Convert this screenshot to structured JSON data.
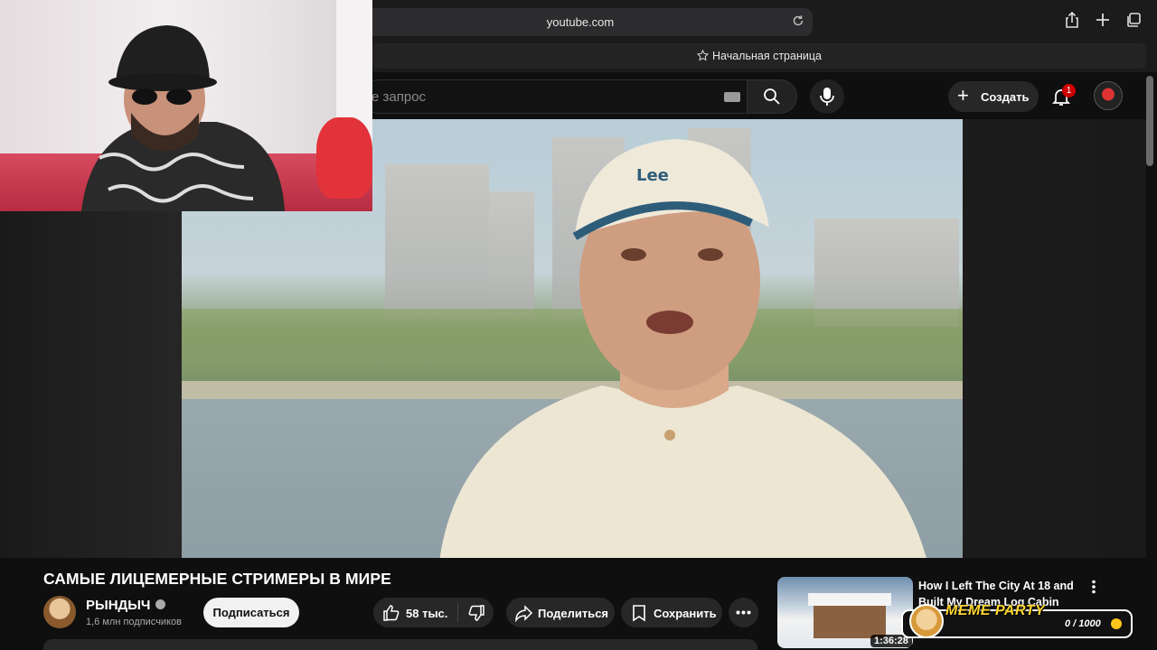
{
  "browser": {
    "url": "youtube.com",
    "tab_title": "Начальная страница"
  },
  "header": {
    "search_placeholder": "е запрос",
    "create_label": "Создать",
    "notification_count": "1"
  },
  "video": {
    "title": "САМЫЕ ЛИЦЕМЕРНЫЕ СТРИМЕРЫ В МИРЕ",
    "cap_text": "Lee"
  },
  "channel": {
    "name": "РЫНДЫЧ",
    "subscribers": "1,6 млн подписчиков",
    "subscribe_label": "Подписаться"
  },
  "actions": {
    "likes": "58 тыс.",
    "share_label": "Поделиться",
    "save_label": "Сохранить"
  },
  "recommendation": {
    "title": "How I Left The City At 18 and Built My Dream Log Cabin",
    "duration": "1:36:28"
  },
  "meme_widget": {
    "label": "MEME PARTY",
    "count": "0 / 1000"
  },
  "colors": {
    "accent_red": "#cc0000",
    "meme_yellow": "#ffd52e"
  }
}
